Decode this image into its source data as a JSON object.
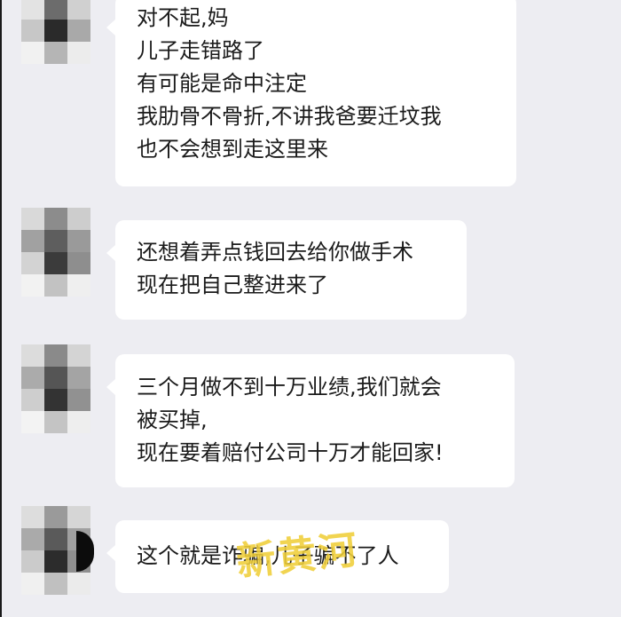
{
  "colors": {
    "background": "#ededf2",
    "bubble": "#ffffff",
    "text": "#1b1b1b",
    "watermark": "#f0cf3a"
  },
  "messages": [
    {
      "lines": [
        "对不起,妈",
        "儿子走错路了",
        "有可能是命中注定",
        "我肋骨不骨折,不讲我爸要迁坟我",
        "也不会想到走这里来"
      ]
    },
    {
      "lines": [
        "还想着弄点钱回去给你做手术",
        "现在把自己整进来了"
      ]
    },
    {
      "lines": [
        "三个月做不到十万业绩,我们就会",
        "被买掉,",
        "现在要着赔付公司十万才能回家!"
      ]
    },
    {
      "lines": [
        "这个就是诈骗,儿子骗不了人"
      ]
    }
  ],
  "watermark_text": "新黄河"
}
